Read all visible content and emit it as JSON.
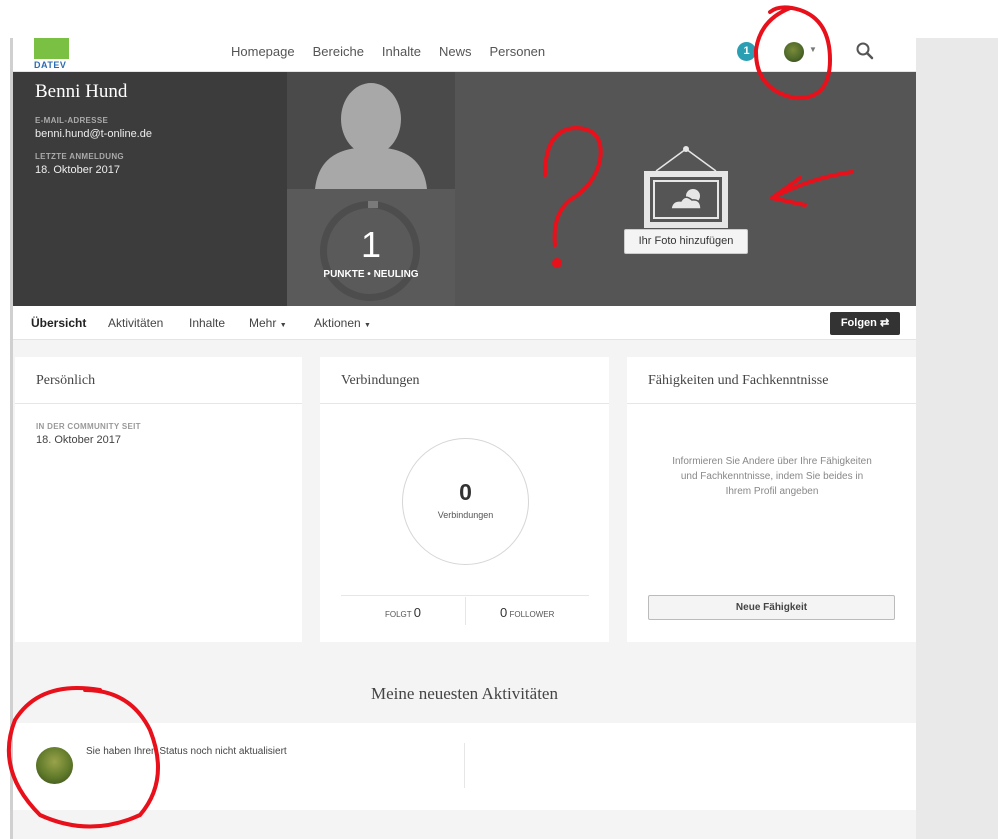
{
  "nav": {
    "logo_text": "DATEV",
    "links": [
      "Homepage",
      "Bereiche",
      "Inhalte",
      "News",
      "Personen"
    ],
    "notification_count": "1"
  },
  "profile": {
    "name": "Benni Hund",
    "email_label": "E-MAIL-ADRESSE",
    "email": "benni.hund@t-online.de",
    "last_login_label": "LETZTE ANMELDUNG",
    "last_login": "18. Oktober 2017",
    "points": "1",
    "points_label": "PUNKTE • NEULING",
    "add_photo_label": "Ihr Foto hinzufügen"
  },
  "subnav": {
    "overview": "Übersicht",
    "activities": "Aktivitäten",
    "content": "Inhalte",
    "more": "Mehr",
    "actions": "Aktionen",
    "follow": "Folgen"
  },
  "personal": {
    "title": "Persönlich",
    "since_label": "IN DER COMMUNITY SEIT",
    "since_value": "18. Oktober 2017"
  },
  "connections": {
    "title": "Verbindungen",
    "count": "0",
    "count_label": "Verbindungen",
    "follows_label": "FOLGT",
    "follows_count": "0",
    "followers_label": "FOLLOWER",
    "followers_count": "0"
  },
  "skills": {
    "title": "Fähigkeiten und Fachkenntnisse",
    "empty_text": "Informieren Sie Andere über Ihre Fähigkeiten und Fachkenntnisse, indem Sie beides in Ihrem Profil angeben",
    "button": "Neue Fähigkeit"
  },
  "activity": {
    "title": "Meine neuesten Aktivitäten",
    "status_text": "Sie haben Ihren Status noch nicht aktualisiert"
  },
  "annotations": {
    "question_mark": "?",
    "color": "#e8101a"
  },
  "colors": {
    "brand_green": "#7ac143",
    "notification": "#2a9fb3",
    "hero_dark": "#3c3c3c"
  }
}
